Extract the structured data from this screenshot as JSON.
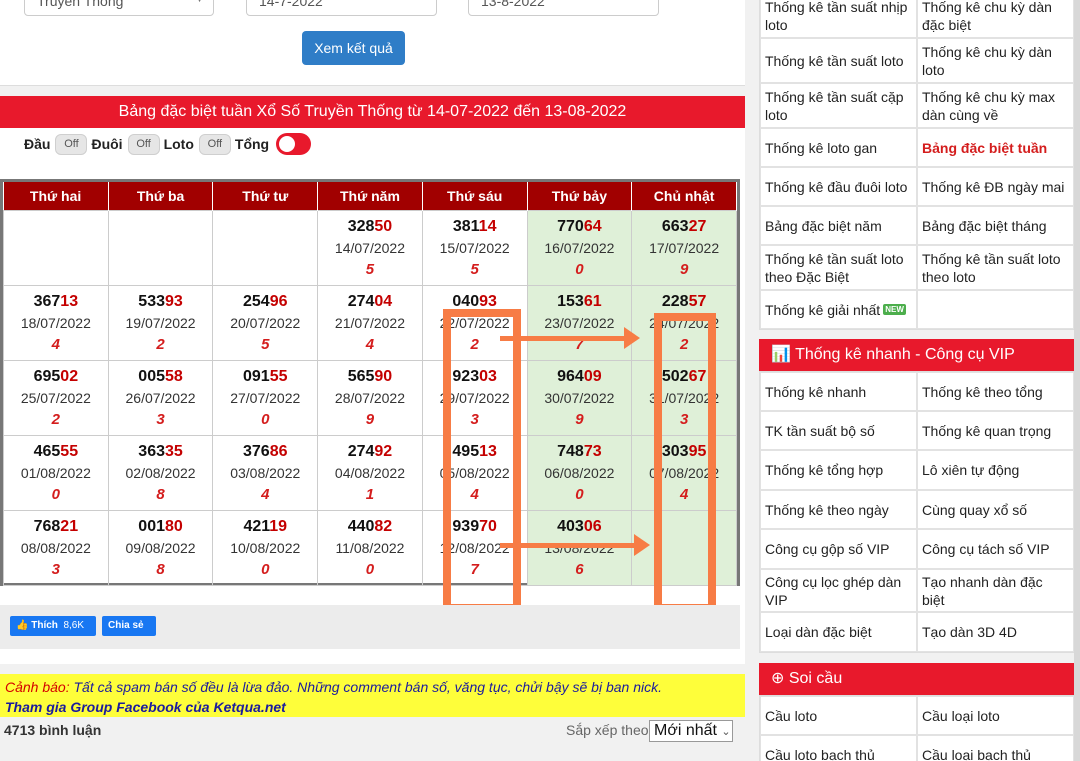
{
  "filters": {
    "lottery_type": "Truyền Thống",
    "from_date": "14-7-2022",
    "to_date": "13-8-2022",
    "submit_label": "Xem kết quả"
  },
  "banner_title": "Bảng đặc biệt tuần Xổ Số Truyền Thống từ 14-07-2022 đến 13-08-2022",
  "toggles": [
    {
      "label": "Đầu",
      "state": "Off"
    },
    {
      "label": "Đuôi",
      "state": "Off"
    },
    {
      "label": "Loto",
      "state": "Off"
    },
    {
      "label": "Tổng",
      "state": "On"
    }
  ],
  "table": {
    "headers": [
      "Thứ hai",
      "Thứ ba",
      "Thứ tư",
      "Thứ năm",
      "Thứ sáu",
      "Thứ bảy",
      "Chủ nhật"
    ],
    "rows": [
      [
        null,
        null,
        null,
        {
          "head": "328",
          "tail": "50",
          "date": "14/07/2022",
          "total": "5"
        },
        {
          "head": "381",
          "tail": "14",
          "date": "15/07/2022",
          "total": "5"
        },
        {
          "head": "770",
          "tail": "64",
          "date": "16/07/2022",
          "total": "0"
        },
        {
          "head": "663",
          "tail": "27",
          "date": "17/07/2022",
          "total": "9"
        }
      ],
      [
        {
          "head": "367",
          "tail": "13",
          "date": "18/07/2022",
          "total": "4"
        },
        {
          "head": "533",
          "tail": "93",
          "date": "19/07/2022",
          "total": "2"
        },
        {
          "head": "254",
          "tail": "96",
          "date": "20/07/2022",
          "total": "5"
        },
        {
          "head": "274",
          "tail": "04",
          "date": "21/07/2022",
          "total": "4"
        },
        {
          "head": "040",
          "tail": "93",
          "date": "22/07/2022",
          "total": "2"
        },
        {
          "head": "153",
          "tail": "61",
          "date": "23/07/2022",
          "total": "7"
        },
        {
          "head": "228",
          "tail": "57",
          "date": "24/07/2022",
          "total": "2"
        }
      ],
      [
        {
          "head": "695",
          "tail": "02",
          "date": "25/07/2022",
          "total": "2"
        },
        {
          "head": "005",
          "tail": "58",
          "date": "26/07/2022",
          "total": "3"
        },
        {
          "head": "091",
          "tail": "55",
          "date": "27/07/2022",
          "total": "0"
        },
        {
          "head": "565",
          "tail": "90",
          "date": "28/07/2022",
          "total": "9"
        },
        {
          "head": "923",
          "tail": "03",
          "date": "29/07/2022",
          "total": "3"
        },
        {
          "head": "964",
          "tail": "09",
          "date": "30/07/2022",
          "total": "9"
        },
        {
          "head": "502",
          "tail": "67",
          "date": "31/07/2022",
          "total": "3"
        }
      ],
      [
        {
          "head": "465",
          "tail": "55",
          "date": "01/08/2022",
          "total": "0"
        },
        {
          "head": "363",
          "tail": "35",
          "date": "02/08/2022",
          "total": "8"
        },
        {
          "head": "376",
          "tail": "86",
          "date": "03/08/2022",
          "total": "4"
        },
        {
          "head": "274",
          "tail": "92",
          "date": "04/08/2022",
          "total": "1"
        },
        {
          "head": "495",
          "tail": "13",
          "date": "05/08/2022",
          "total": "4"
        },
        {
          "head": "748",
          "tail": "73",
          "date": "06/08/2022",
          "total": "0"
        },
        {
          "head": "303",
          "tail": "95",
          "date": "07/08/2022",
          "total": "4"
        }
      ],
      [
        {
          "head": "768",
          "tail": "21",
          "date": "08/08/2022",
          "total": "3"
        },
        {
          "head": "001",
          "tail": "80",
          "date": "09/08/2022",
          "total": "8"
        },
        {
          "head": "421",
          "tail": "19",
          "date": "10/08/2022",
          "total": "0"
        },
        {
          "head": "440",
          "tail": "82",
          "date": "11/08/2022",
          "total": "0"
        },
        {
          "head": "939",
          "tail": "70",
          "date": "12/08/2022",
          "total": "7"
        },
        {
          "head": "403",
          "tail": "06",
          "date": "13/08/2022",
          "total": "6"
        },
        null
      ]
    ]
  },
  "social": {
    "like_label": "Thích",
    "like_count": "8,6K",
    "share_label": "Chia sẻ"
  },
  "warning": {
    "prefix": "Cảnh báo:",
    "text": "Tất cả spam bán số đều là lừa đảo. Những comment bán số, văng tục, chửi bậy sẽ bị ban nick.",
    "link": "Tham gia Group Facebook của Ketqua.net"
  },
  "comments": {
    "count": "4713 bình luận",
    "sort_label": "Sắp xếp theo",
    "sort_value": "Mới nhất"
  },
  "sidebar": {
    "stats_rows": [
      [
        "Thống kê tần suất nhịp loto",
        "Thống kê chu kỳ dàn đặc biệt"
      ],
      [
        "Thống kê tần suất loto",
        "Thống kê chu kỳ dàn loto"
      ],
      [
        "Thống kê tần suất cặp loto",
        "Thống kê chu kỳ max dàn cùng về"
      ],
      [
        "Thống kê loto gan",
        "Bảng đặc biệt tuần"
      ],
      [
        "Thống kê đầu đuôi loto",
        "Thống kê ĐB ngày mai"
      ],
      [
        "Bảng đặc biệt năm",
        "Bảng đặc biệt tháng"
      ],
      [
        "Thống kê tần suất loto theo Đặc Biệt",
        "Thống kê tần suất loto theo loto"
      ],
      [
        "Thống kê giải nhất",
        ""
      ]
    ],
    "new_badge": "NEW",
    "quick_title": "Thống kê nhanh - Công cụ VIP",
    "quick_rows": [
      [
        "Thống kê nhanh",
        "Thống kê theo tổng"
      ],
      [
        "TK tần suất bộ số",
        "Thống kê quan trọng"
      ],
      [
        "Thống kê tổng hợp",
        "Lô xiên tự động"
      ],
      [
        "Thống kê theo ngày",
        "Cùng quay xổ số"
      ],
      [
        "Công cụ gộp số VIP",
        "Công cụ tách số VIP"
      ],
      [
        "Công cụ lọc ghép dàn VIP",
        "Tạo nhanh dàn đặc biệt"
      ],
      [
        "Loại dàn đặc biệt",
        "Tạo dàn 3D 4D"
      ]
    ],
    "soi_title": "Soi cầu",
    "soi_rows": [
      [
        "Cầu loto",
        "Cầu loại loto"
      ],
      [
        "Cầu loto bạch thủ",
        "Cầu loại bạch thủ"
      ]
    ]
  },
  "colors": {
    "banner_red": "#e8192c",
    "header_dark_red": "#a10000",
    "weekend_green": "#dff0d8",
    "annotation_orange": "#f77c45",
    "button_blue": "#2f7dc7"
  }
}
